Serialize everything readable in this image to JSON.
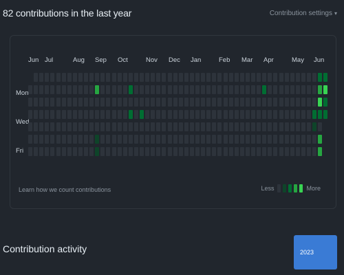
{
  "header": {
    "title": "82 contributions in the last year",
    "settings_label": "Contribution settings"
  },
  "calendar": {
    "months": [
      "Jun",
      "Jul",
      "Aug",
      "Sep",
      "Oct",
      "Nov",
      "Dec",
      "Jan",
      "Feb",
      "Mar",
      "Apr",
      "May",
      "Jun"
    ],
    "day_labels": [
      "Mon",
      "Wed",
      "Fri"
    ],
    "week_count": 53,
    "colors": {
      "level0": "#2d333b",
      "level1": "#0e4429",
      "level2": "#006d32",
      "level3": "#26a641",
      "level4": "#39d353"
    },
    "contributions": [
      {
        "week": 12,
        "day": 1,
        "level": 3
      },
      {
        "week": 12,
        "day": 5,
        "level": 1
      },
      {
        "week": 12,
        "day": 6,
        "level": 1
      },
      {
        "week": 18,
        "day": 1,
        "level": 2
      },
      {
        "week": 18,
        "day": 3,
        "level": 2
      },
      {
        "week": 20,
        "day": 3,
        "level": 2
      },
      {
        "week": 42,
        "day": 1,
        "level": 2
      },
      {
        "week": 51,
        "day": 3,
        "level": 2
      },
      {
        "week": 51,
        "day": 4,
        "level": 1
      },
      {
        "week": 52,
        "day": 0,
        "level": 2
      },
      {
        "week": 52,
        "day": 1,
        "level": 3
      },
      {
        "week": 52,
        "day": 2,
        "level": 4
      },
      {
        "week": 52,
        "day": 3,
        "level": 2
      },
      {
        "week": 52,
        "day": 5,
        "level": 3
      },
      {
        "week": 52,
        "day": 6,
        "level": 3
      },
      {
        "week": 53,
        "day": 0,
        "level": 2
      },
      {
        "week": 53,
        "day": 1,
        "level": 4
      },
      {
        "week": 53,
        "day": 2,
        "level": 2
      },
      {
        "week": 53,
        "day": 3,
        "level": 2
      }
    ],
    "learn_link": "Learn how we count contributions",
    "legend_less": "Less",
    "legend_more": "More"
  },
  "activity": {
    "title": "Contribution activity",
    "year_label": "2023"
  }
}
